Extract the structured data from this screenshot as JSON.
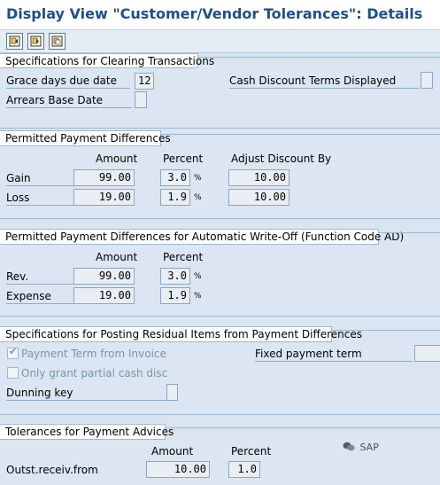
{
  "title": "Display View \"Customer/Vendor Tolerances\": Details",
  "toolbar": {
    "icons": [
      "previous-entry-icon",
      "next-entry-icon",
      "other-entry-icon"
    ]
  },
  "clearing": {
    "heading": "Specifications for Clearing Transactions",
    "grace_label": "Grace days due date",
    "grace_value": "12",
    "cash_discount_label": "Cash Discount Terms Displayed",
    "cash_discount_value": "",
    "arrears_label": "Arrears Base Date",
    "arrears_value": ""
  },
  "permitted": {
    "heading": "Permitted Payment Differences",
    "col_amount": "Amount",
    "col_percent": "Percent",
    "col_adjust": "Adjust Discount By",
    "rows": [
      {
        "label": "Gain",
        "amount": "99.00",
        "percent": "3.0",
        "unit": "%",
        "adjust": "10.00"
      },
      {
        "label": "Loss",
        "amount": "19.00",
        "percent": "1.9",
        "unit": "%",
        "adjust": "10.00"
      }
    ]
  },
  "writeoff": {
    "heading": "Permitted Payment Differences for Automatic Write-Off (Function Code AD)",
    "col_amount": "Amount",
    "col_percent": "Percent",
    "rows": [
      {
        "label": "Rev.",
        "amount": "99.00",
        "percent": "3.0",
        "unit": "%"
      },
      {
        "label": "Expense",
        "amount": "19.00",
        "percent": "1.9",
        "unit": "%"
      }
    ]
  },
  "residual": {
    "heading": "Specifications for Posting Residual Items from Payment Differences",
    "payment_term_label": "Payment Term from Invoice",
    "payment_term_checked": true,
    "partial_cash_label": "Only grant partial cash disc",
    "partial_cash_checked": false,
    "dunning_label": "Dunning key",
    "dunning_value": "",
    "fixed_term_label": "Fixed payment term",
    "fixed_term_value": ""
  },
  "advices": {
    "heading": "Tolerances for Payment Advices",
    "col_amount": "Amount",
    "col_percent": "Percent",
    "row_label": "Outst.receiv.from",
    "row_amount": "10.00",
    "row_percent": "1.0"
  },
  "watermark": {
    "text": "SAP"
  }
}
